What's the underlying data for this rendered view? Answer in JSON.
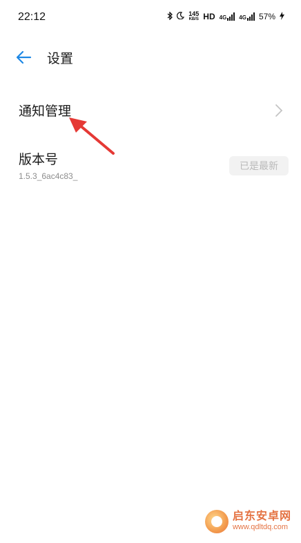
{
  "status_bar": {
    "time": "22:12",
    "net_speed_value": "145",
    "net_speed_unit": "KB/S",
    "hd_label": "HD",
    "sim1_tag": "4G",
    "sim2_tag": "4G",
    "battery": "57%"
  },
  "header": {
    "title": "设置",
    "back_icon": "arrow-left-icon"
  },
  "settings": {
    "notification_label": "通知管理",
    "version_label": "版本号",
    "version_value": "1.5.3_6ac4c83_",
    "latest_badge": "已是最新"
  },
  "watermark": {
    "title": "启东安卓网",
    "url": "www.qdltdq.com"
  },
  "colors": {
    "accent": "#1e88e5",
    "annotation_arrow": "#e53935",
    "badge_bg": "#f2f2f2",
    "badge_text": "#b9b9b9"
  }
}
